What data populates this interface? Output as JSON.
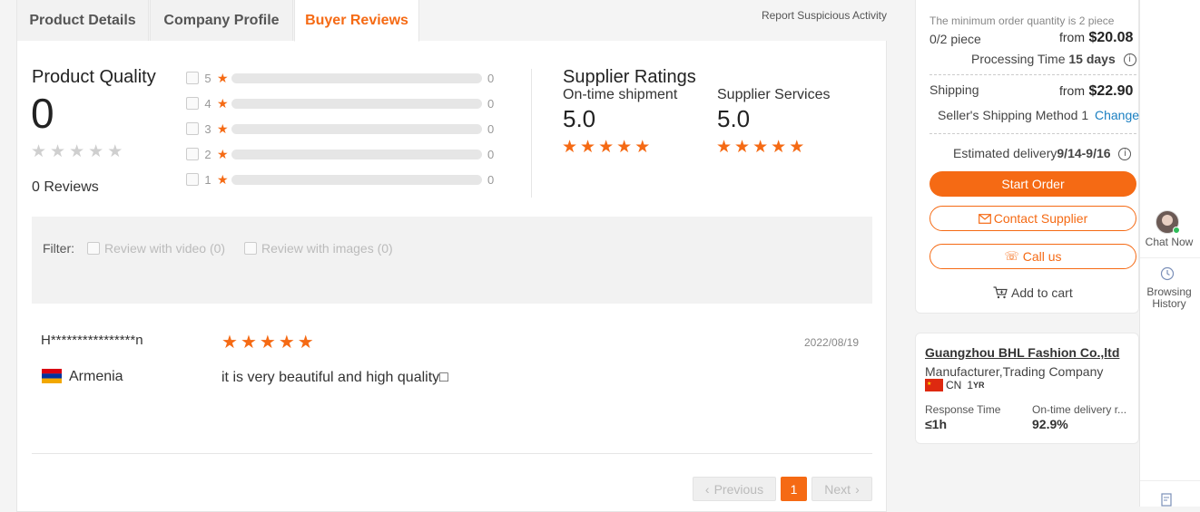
{
  "tabs": [
    {
      "label": "Product Details"
    },
    {
      "label": "Company Profile"
    },
    {
      "label": "Buyer Reviews"
    }
  ],
  "report_link": "Report Suspicious Activity",
  "product_quality": {
    "title": "Product Quality",
    "score": "0",
    "reviews_label": "0 Reviews",
    "rows": [
      {
        "star": "5",
        "count": "0"
      },
      {
        "star": "4",
        "count": "0"
      },
      {
        "star": "3",
        "count": "0"
      },
      {
        "star": "2",
        "count": "0"
      },
      {
        "star": "1",
        "count": "0"
      }
    ]
  },
  "supplier_ratings": {
    "title": "Supplier Ratings",
    "items": [
      {
        "label": "On-time shipment",
        "value": "5.0"
      },
      {
        "label": "Supplier Services",
        "value": "5.0"
      }
    ]
  },
  "filter": {
    "label": "Filter:",
    "options": [
      "Review with video (0)",
      "Review with images (0)"
    ]
  },
  "review": {
    "name": "H****************n",
    "country": "Armenia",
    "date": "2022/08/19",
    "text": "it is very beautiful and high quality□",
    "rating": 5
  },
  "pagination": {
    "prev": "Previous",
    "current": "1",
    "next": "Next"
  },
  "order": {
    "min_order": "The minimum order quantity is 2 piece",
    "qty": "0/2 piece",
    "from": "from",
    "price": "$20.08",
    "processing_label": "Processing Time",
    "processing_value": "15 days",
    "shipping_label": "Shipping",
    "shipping_price": "$22.90",
    "shipping_method": "Seller's Shipping Method 1",
    "change": "Change",
    "est_label": "Estimated delivery",
    "est_value": "9/14-9/16",
    "start_order": "Start Order",
    "contact": "Contact Supplier",
    "call": "Call us",
    "cart": "Add to cart"
  },
  "company": {
    "name": "Guangzhou BHL Fashion Co.,ltd",
    "type": "Manufacturer,Trading Company",
    "country_code": "CN",
    "years": "1",
    "years_unit": "YR",
    "response_label": "Response Time",
    "response_value": "≤1h",
    "ontime_label": "On-time delivery r...",
    "ontime_value": "92.9%"
  },
  "rail": {
    "chat": "Chat Now",
    "history_line1": "Browsing",
    "history_line2": "History"
  },
  "colors": {
    "accent": "#f56a14",
    "star_empty": "#cfcfcf"
  }
}
